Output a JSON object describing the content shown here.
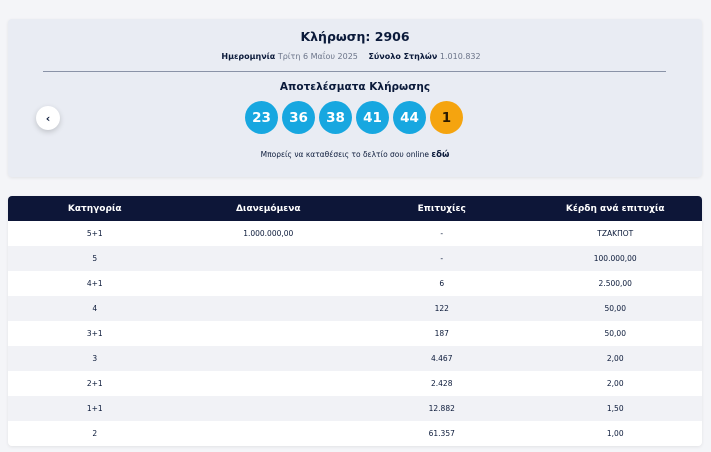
{
  "draw": {
    "title": "Κλήρωση: 2906",
    "date_label": "Ημερομηνία",
    "date_value": "Τρίτη 6 Μαΐου 2025",
    "columns_label": "Σύνολο Στηλών",
    "columns_value": "1.010.832"
  },
  "results": {
    "title": "Αποτελέσματα Κλήρωσης",
    "numbers": [
      "23",
      "36",
      "38",
      "41",
      "44"
    ],
    "bonus": "1",
    "ball_color": "#17a7e0",
    "bonus_color": "#f5a40f"
  },
  "online": {
    "text": "Μπορείς να καταθέσεις το δελτίο σου online",
    "link": "εδώ"
  },
  "table": {
    "headers": [
      "Κατηγορία",
      "Διανεμόμενα",
      "Επιτυχίες",
      "Κέρδη ανά επιτυχία"
    ],
    "rows": [
      [
        "5+1",
        "1.000.000,00",
        "-",
        "ΤΖΑΚΠΟΤ"
      ],
      [
        "5",
        "",
        "-",
        "100.000,00"
      ],
      [
        "4+1",
        "",
        "6",
        "2.500,00"
      ],
      [
        "4",
        "",
        "122",
        "50,00"
      ],
      [
        "3+1",
        "",
        "187",
        "50,00"
      ],
      [
        "3",
        "",
        "4.467",
        "2,00"
      ],
      [
        "2+1",
        "",
        "2.428",
        "2,00"
      ],
      [
        "1+1",
        "",
        "12.882",
        "1,50"
      ],
      [
        "2",
        "",
        "61.357",
        "1,00"
      ]
    ]
  },
  "nav": {
    "prev_icon": "chevron-left-icon"
  }
}
